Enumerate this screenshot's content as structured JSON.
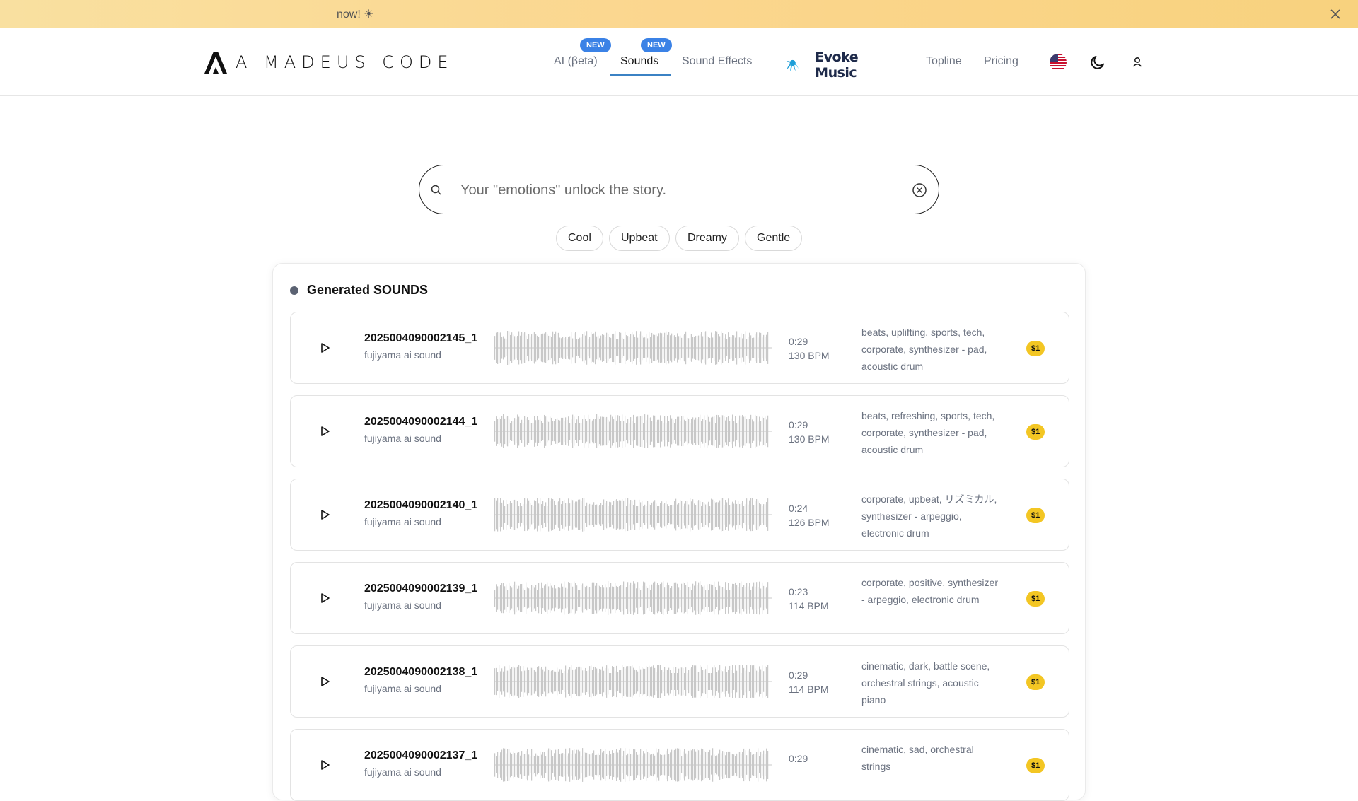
{
  "banner": {
    "text": "now! ☀"
  },
  "header": {
    "logo_text": "A MADEUS CODE",
    "nav": {
      "ai": "AI (βeta)",
      "sounds": "Sounds",
      "sound_effects": "Sound Effects",
      "evoke": "Evoke Music",
      "topline": "Topline",
      "pricing": "Pricing"
    },
    "badge_new": "NEW"
  },
  "search": {
    "placeholder": "Your \"emotions\" unlock the story."
  },
  "chips": [
    "Cool",
    "Upbeat",
    "Dreamy",
    "Gentle"
  ],
  "panel": {
    "title": "Generated SOUNDS",
    "tracks": [
      {
        "name": "2025004090002145_1",
        "artist": "fujiyama ai sound",
        "duration": "0:29",
        "bpm": "130 BPM",
        "tags": "beats, uplifting, sports, tech, corporate, synthesizer - pad, acoustic drum",
        "price": "$1"
      },
      {
        "name": "2025004090002144_1",
        "artist": "fujiyama ai sound",
        "duration": "0:29",
        "bpm": "130 BPM",
        "tags": "beats, refreshing, sports, tech, corporate, synthesizer - pad, acoustic drum",
        "price": "$1"
      },
      {
        "name": "2025004090002140_1",
        "artist": "fujiyama ai sound",
        "duration": "0:24",
        "bpm": "126 BPM",
        "tags": "corporate, upbeat, リズミカル, synthesizer - arpeggio, electronic drum",
        "price": "$1"
      },
      {
        "name": "2025004090002139_1",
        "artist": "fujiyama ai sound",
        "duration": "0:23",
        "bpm": "114 BPM",
        "tags": "corporate, positive, synthesizer - arpeggio, electronic drum",
        "price": "$1"
      },
      {
        "name": "2025004090002138_1",
        "artist": "fujiyama ai sound",
        "duration": "0:29",
        "bpm": "114 BPM",
        "tags": "cinematic, dark, battle scene, orchestral strings, acoustic piano",
        "price": "$1"
      },
      {
        "name": "2025004090002137_1",
        "artist": "fujiyama ai sound",
        "duration": "0:29",
        "bpm": "",
        "tags": "cinematic, sad, orchestral strings",
        "price": "$1"
      }
    ]
  },
  "colors": {
    "accent": "#3b82e6",
    "underline": "#3b82c4",
    "price_badge": "#f3c623",
    "banner": "#fbd68e",
    "waveform": "#c8c8c8"
  },
  "icons": {
    "banner_close": "close-icon",
    "search": "search-icon",
    "clear": "clear-circle-icon",
    "theme": "moon-icon",
    "user": "user-icon",
    "flag": "us-flag-icon",
    "play": "play-icon"
  }
}
